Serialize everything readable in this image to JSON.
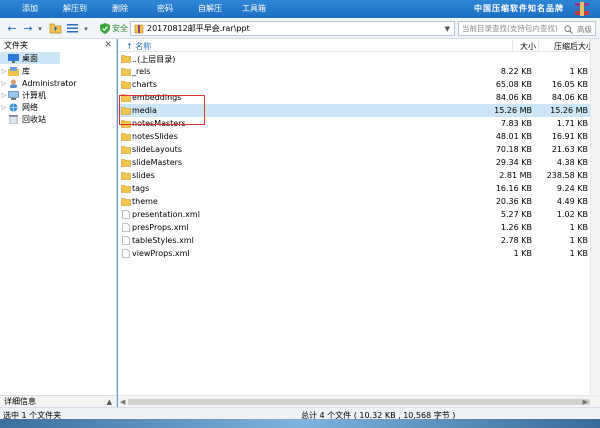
{
  "toolbar": {
    "items": [
      "添加",
      "解压到",
      "删除",
      "密码",
      "自解压",
      "工具箱"
    ],
    "brand": "中国压缩软件知名品牌"
  },
  "nav": {
    "safe_label": "安全",
    "path": "20170812邮平早会.rar\\ppt",
    "search_placeholder": "当前目录查找(支持包内查找)",
    "search_button": "高级"
  },
  "left_pane": {
    "title": "文件夹",
    "tree": [
      {
        "label": "桌面",
        "icon": "desktop-icon"
      },
      {
        "label": "库",
        "icon": "library-icon"
      },
      {
        "label": "Administrator",
        "icon": "user-icon"
      },
      {
        "label": "计算机",
        "icon": "computer-icon"
      },
      {
        "label": "网络",
        "icon": "network-icon"
      },
      {
        "label": "回收站",
        "icon": "recycle-bin-icon"
      }
    ],
    "detail_label": "详细信息"
  },
  "columns": {
    "name": "名称",
    "size": "大小",
    "packed": "压缩后大小"
  },
  "files": [
    {
      "name": "..(上层目录)",
      "size": "",
      "packed": "",
      "type": "folder"
    },
    {
      "name": "_rels",
      "size": "8.22 KB",
      "packed": "1 KB",
      "type": "folder"
    },
    {
      "name": "charts",
      "size": "65.08 KB",
      "packed": "16.05 KB",
      "type": "folder"
    },
    {
      "name": "embeddings",
      "size": "84.06 KB",
      "packed": "84.06 KB",
      "type": "folder"
    },
    {
      "name": "media",
      "size": "15.26 MB",
      "packed": "15.26 MB",
      "type": "folder"
    },
    {
      "name": "notesMasters",
      "size": "7.83 KB",
      "packed": "1.71 KB",
      "type": "folder"
    },
    {
      "name": "notesSlides",
      "size": "48.01 KB",
      "packed": "16.91 KB",
      "type": "folder"
    },
    {
      "name": "slideLayouts",
      "size": "70.18 KB",
      "packed": "21.63 KB",
      "type": "folder"
    },
    {
      "name": "slideMasters",
      "size": "29.34 KB",
      "packed": "4.38 KB",
      "type": "folder"
    },
    {
      "name": "slides",
      "size": "2.81 MB",
      "packed": "238.58 KB",
      "type": "folder"
    },
    {
      "name": "tags",
      "size": "16.16 KB",
      "packed": "9.24 KB",
      "type": "folder"
    },
    {
      "name": "theme",
      "size": "20.36 KB",
      "packed": "4.49 KB",
      "type": "folder"
    },
    {
      "name": "presentation.xml",
      "size": "5.27 KB",
      "packed": "1.02 KB",
      "type": "file"
    },
    {
      "name": "presProps.xml",
      "size": "1.26 KB",
      "packed": "1 KB",
      "type": "file"
    },
    {
      "name": "tableStyles.xml",
      "size": "2.78 KB",
      "packed": "1 KB",
      "type": "file"
    },
    {
      "name": "viewProps.xml",
      "size": "1 KB",
      "packed": "1 KB",
      "type": "file"
    }
  ],
  "status": {
    "selected": "选中 1 个文件夹",
    "summary": "总计 4 个文件 ( 10.32 KB , 10,568 字节 )"
  }
}
